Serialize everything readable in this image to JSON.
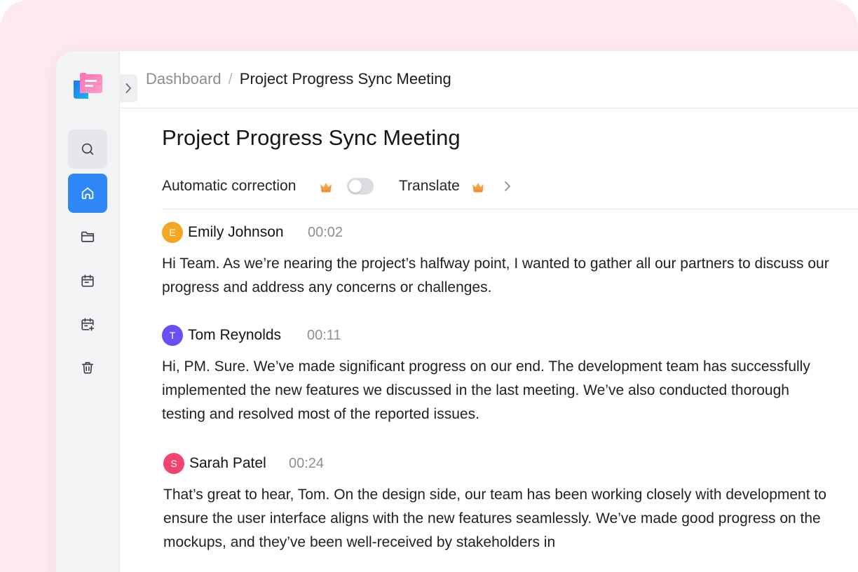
{
  "breadcrumb": {
    "root": "Dashboard",
    "separator": "/",
    "current": "Project Progress Sync Meeting"
  },
  "page": {
    "title": "Project Progress Sync Meeting"
  },
  "toolbar": {
    "auto_correction_label": "Automatic correction",
    "auto_correction_enabled": false,
    "translate_label": "Translate"
  },
  "sidebar": {
    "items": [
      {
        "icon": "search-icon",
        "active": false
      },
      {
        "icon": "home-icon",
        "active": true
      },
      {
        "icon": "folder-icon",
        "active": false
      },
      {
        "icon": "calendar-icon",
        "active": false
      },
      {
        "icon": "calendar-add-icon",
        "active": false
      },
      {
        "icon": "trash-icon",
        "active": false
      }
    ]
  },
  "colors": {
    "accent": "#2f86f6",
    "background_pink": "#fce9f2",
    "premium_crown": "#f29a3a"
  },
  "transcript": [
    {
      "initial": "E",
      "speaker": "Emily Johnson",
      "time": "00:02",
      "color": "#f5a623",
      "text": "Hi Team. As we’re nearing the project’s halfway point, I wanted to gather all our partners to discuss our progress and address any concerns or challenges."
    },
    {
      "initial": "T",
      "speaker": "Tom Reynolds",
      "time": "00:11",
      "color": "#6c4ef5",
      "text": "Hi, PM. Sure. We’ve made significant progress on our end. The development team has successfully implemented the new features we discussed in the last meeting. We’ve also conducted thorough testing and resolved most of the reported issues."
    },
    {
      "initial": "S",
      "speaker": "Sarah Patel",
      "time": "00:24",
      "color": "#f0436d",
      "text": "That’s great to hear, Tom. On the design side, our team has been working closely with development to ensure the user interface aligns with the new features seamlessly. We’ve made good progress on the mockups, and they’ve been well-received by stakeholders in"
    }
  ]
}
